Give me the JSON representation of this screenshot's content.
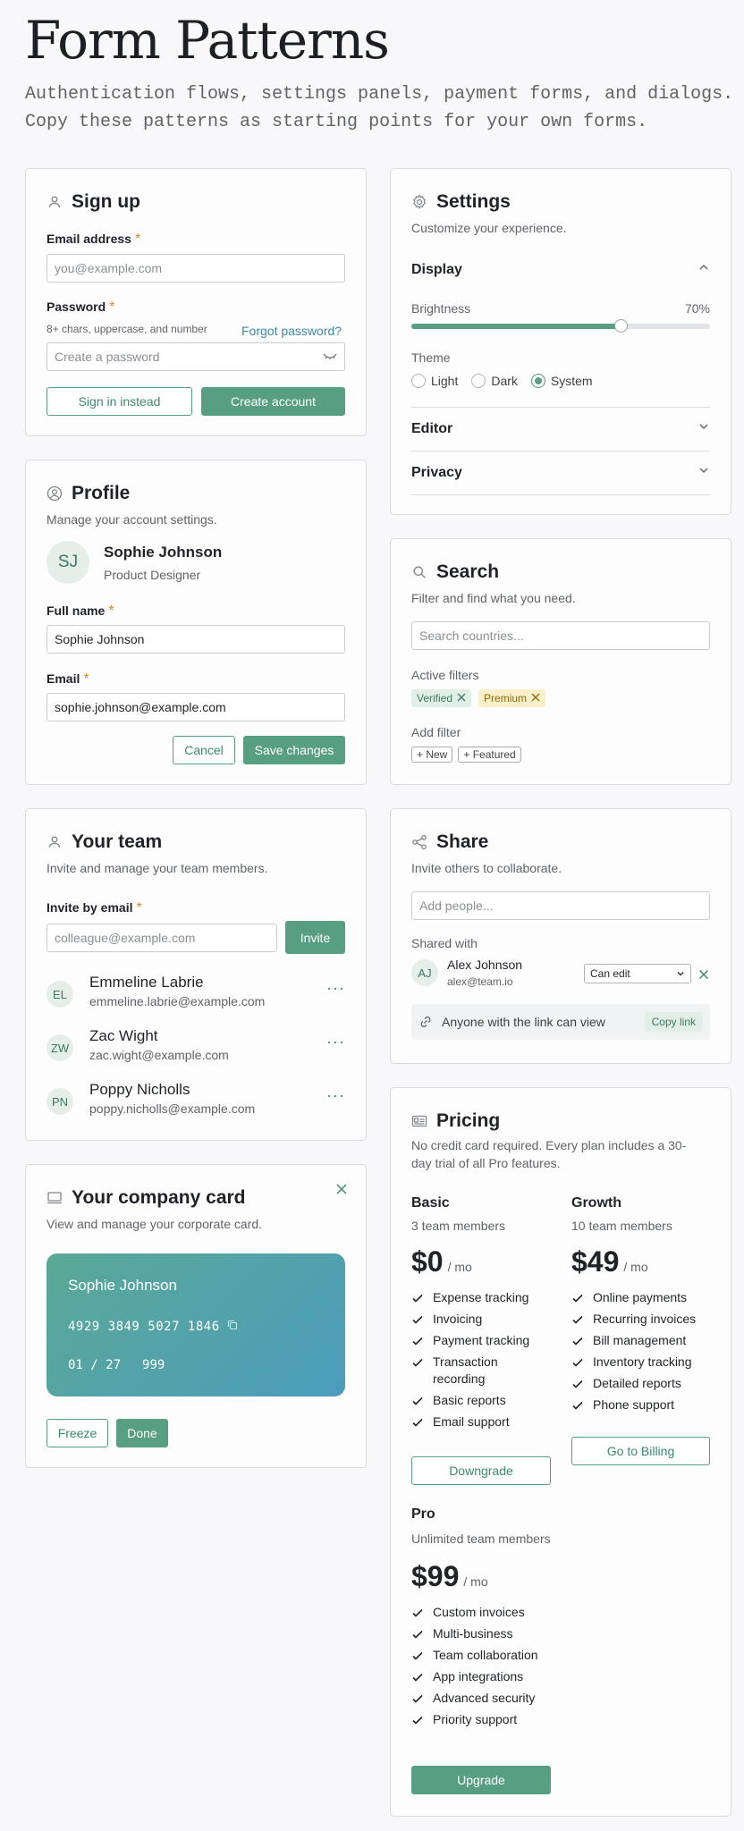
{
  "header": {
    "title": "Form Patterns",
    "desc_line1": "Authentication flows, settings panels, payment forms, and dialogs.",
    "desc_line2": "Copy these patterns as starting points for your own forms."
  },
  "signup": {
    "title": "Sign up",
    "email_label": "Email address",
    "email_placeholder": "you@example.com",
    "password_label": "Password",
    "password_hint": "8+ chars, uppercase, and number",
    "forgot": "Forgot password?",
    "password_placeholder": "Create a password",
    "signin_label": "Sign in instead",
    "create_label": "Create account",
    "required_mark": "*"
  },
  "profile": {
    "title": "Profile",
    "subtitle": "Manage your account settings.",
    "initials": "SJ",
    "name": "Sophie Johnson",
    "role": "Product Designer",
    "fullname_label": "Full name",
    "fullname_value": "Sophie Johnson",
    "email_label": "Email",
    "email_value": "sophie.johnson@example.com",
    "cancel_label": "Cancel",
    "save_label": "Save changes"
  },
  "team": {
    "title": "Your team",
    "subtitle": "Invite and manage your team members.",
    "invite_label": "Invite by email",
    "invite_placeholder": "colleague@example.com",
    "invite_button": "Invite",
    "members": [
      {
        "initials": "EL",
        "name": "Emmeline Labrie",
        "email": "emmeline.labrie@example.com"
      },
      {
        "initials": "ZW",
        "name": "Zac Wight",
        "email": "zac.wight@example.com"
      },
      {
        "initials": "PN",
        "name": "Poppy Nicholls",
        "email": "poppy.nicholls@example.com"
      }
    ],
    "more": "···"
  },
  "company_card": {
    "title": "Your company card",
    "subtitle": "View and manage your corporate card.",
    "holder": "Sophie Johnson",
    "number": "4929 3849 5027 1846",
    "expiry": "01 / 27",
    "cvv": "999",
    "freeze_label": "Freeze",
    "done_label": "Done"
  },
  "settings": {
    "title": "Settings",
    "subtitle": "Customize your experience.",
    "display_label": "Display",
    "brightness_label": "Brightness",
    "brightness_value": "70%",
    "brightness_fraction": 0.7,
    "theme_label": "Theme",
    "theme_options": [
      "Light",
      "Dark",
      "System"
    ],
    "theme_selected": "System",
    "editor_label": "Editor",
    "privacy_label": "Privacy"
  },
  "search": {
    "title": "Search",
    "subtitle": "Filter and find what you need.",
    "placeholder": "Search countries...",
    "active_label": "Active filters",
    "active_filters": [
      "Verified",
      "Premium"
    ],
    "add_label": "Add filter",
    "add_options": [
      "+ New",
      "+ Featured"
    ]
  },
  "share": {
    "title": "Share",
    "subtitle": "Invite others to collaborate.",
    "placeholder": "Add people...",
    "shared_label": "Shared with",
    "person_initials": "AJ",
    "person_name": "Alex Johnson",
    "person_email": "alex@team.io",
    "permission": "Can edit",
    "link_text": "Anyone with the link can view",
    "copy_label": "Copy link"
  },
  "pricing": {
    "title": "Pricing",
    "subtitle_line1": "No credit card required. Every plan includes a 30-",
    "subtitle_line2": "day trial of all Pro features.",
    "per": "/ mo",
    "plans": [
      {
        "name": "Basic",
        "members": "3 team members",
        "price": "$0",
        "features": [
          "Expense tracking",
          "Invoicing",
          "Payment tracking",
          "Transaction recording",
          "Basic reports",
          "Email support"
        ],
        "button": "Downgrade"
      },
      {
        "name": "Growth",
        "members": "10 team members",
        "price": "$49",
        "features": [
          "Online payments",
          "Recurring invoices",
          "Bill management",
          "Inventory tracking",
          "Detailed reports",
          "Phone support"
        ],
        "button": "Go to Billing"
      },
      {
        "name": "Pro",
        "members": "Unlimited team members",
        "price": "$99",
        "features": [
          "Custom invoices",
          "Multi-business",
          "Team collaboration",
          "App integrations",
          "Advanced security",
          "Priority support"
        ],
        "button": "Upgrade"
      }
    ]
  },
  "colors": {
    "accent": "#579e82",
    "required": "#d18b2e",
    "link": "#3a8aa8",
    "card_gradient_start": "#5aa996",
    "card_gradient_end": "#4d9cbd"
  }
}
